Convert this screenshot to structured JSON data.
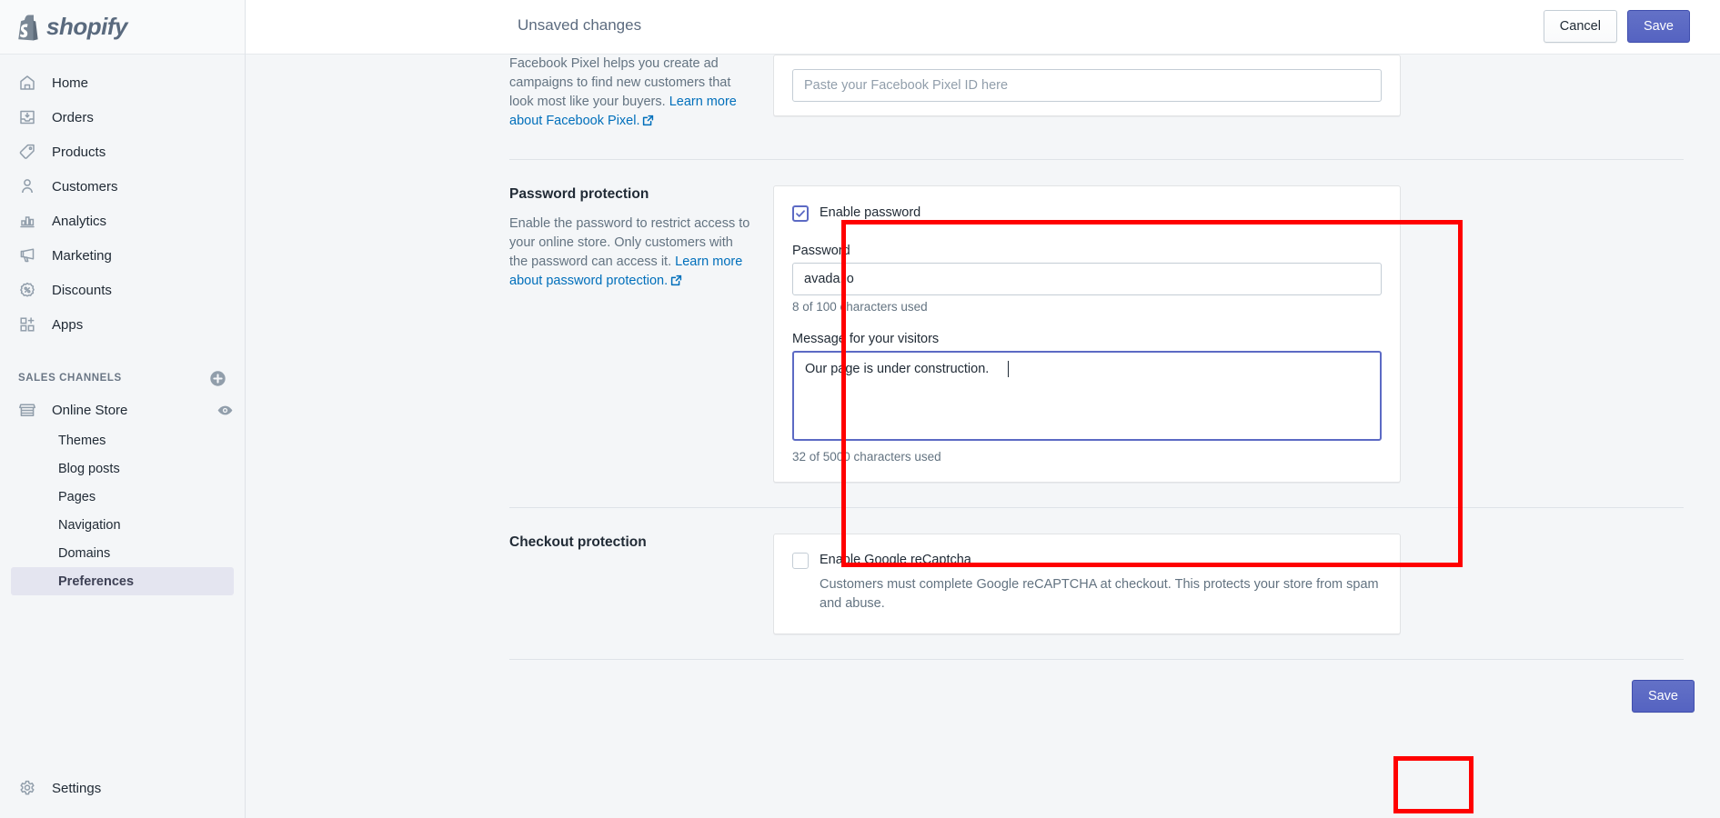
{
  "brand": {
    "name": "shopify",
    "logo_icon": "shopify-bag-logo"
  },
  "sidebar": {
    "main_items": [
      {
        "label": "Home",
        "icon": "home-icon"
      },
      {
        "label": "Orders",
        "icon": "orders-inbox-icon"
      },
      {
        "label": "Products",
        "icon": "products-tag-icon"
      },
      {
        "label": "Customers",
        "icon": "customers-person-icon"
      },
      {
        "label": "Analytics",
        "icon": "analytics-bars-icon"
      },
      {
        "label": "Marketing",
        "icon": "marketing-megaphone-icon"
      },
      {
        "label": "Discounts",
        "icon": "discounts-percent-icon"
      },
      {
        "label": "Apps",
        "icon": "apps-grid-plus-icon"
      }
    ],
    "sales_channels_title": "SALES CHANNELS",
    "add_channel_icon": "plus-circle-icon",
    "online_store": {
      "label": "Online Store",
      "icon": "store-icon",
      "view_icon": "eye-icon"
    },
    "sub_items": [
      {
        "label": "Themes",
        "active": false
      },
      {
        "label": "Blog posts",
        "active": false
      },
      {
        "label": "Pages",
        "active": false
      },
      {
        "label": "Navigation",
        "active": false
      },
      {
        "label": "Domains",
        "active": false
      },
      {
        "label": "Preferences",
        "active": true
      }
    ],
    "settings": {
      "label": "Settings",
      "icon": "gear-icon"
    }
  },
  "topbar": {
    "title": "Unsaved changes",
    "cancel_label": "Cancel",
    "save_label": "Save"
  },
  "facebook_pixel": {
    "description_1": "Facebook Pixel helps you create ad campaigns to find new customers that look most like your buyers. ",
    "link_text": "Learn more about Facebook Pixel.",
    "link_icon": "external-link-icon",
    "input_placeholder": "Paste your Facebook Pixel ID here",
    "input_value": ""
  },
  "password_protection": {
    "title": "Password protection",
    "description_1": "Enable the password to restrict access to your online store. Only customers with the password can access it. ",
    "link_text": "Learn more about password protection.",
    "link_icon": "external-link-icon",
    "enable_label": "Enable password",
    "enable_checked": true,
    "password_label": "Password",
    "password_value": "avada.io",
    "password_counter": "8 of 100 characters used",
    "message_label": "Message for your visitors",
    "message_value": "Our page is under construction.",
    "message_counter": "32 of 5000 characters used"
  },
  "checkout_protection": {
    "title": "Checkout protection",
    "recaptcha_label": "Enable Google reCaptcha",
    "recaptcha_checked": false,
    "recaptcha_description": "Customers must complete Google reCAPTCHA at checkout. This protects your store from spam and abuse."
  },
  "footer": {
    "save_label": "Save"
  },
  "annotations": {
    "color": "#FF0000",
    "boxes": [
      {
        "name": "password-card-highlight"
      },
      {
        "name": "bottom-save-highlight"
      }
    ]
  }
}
